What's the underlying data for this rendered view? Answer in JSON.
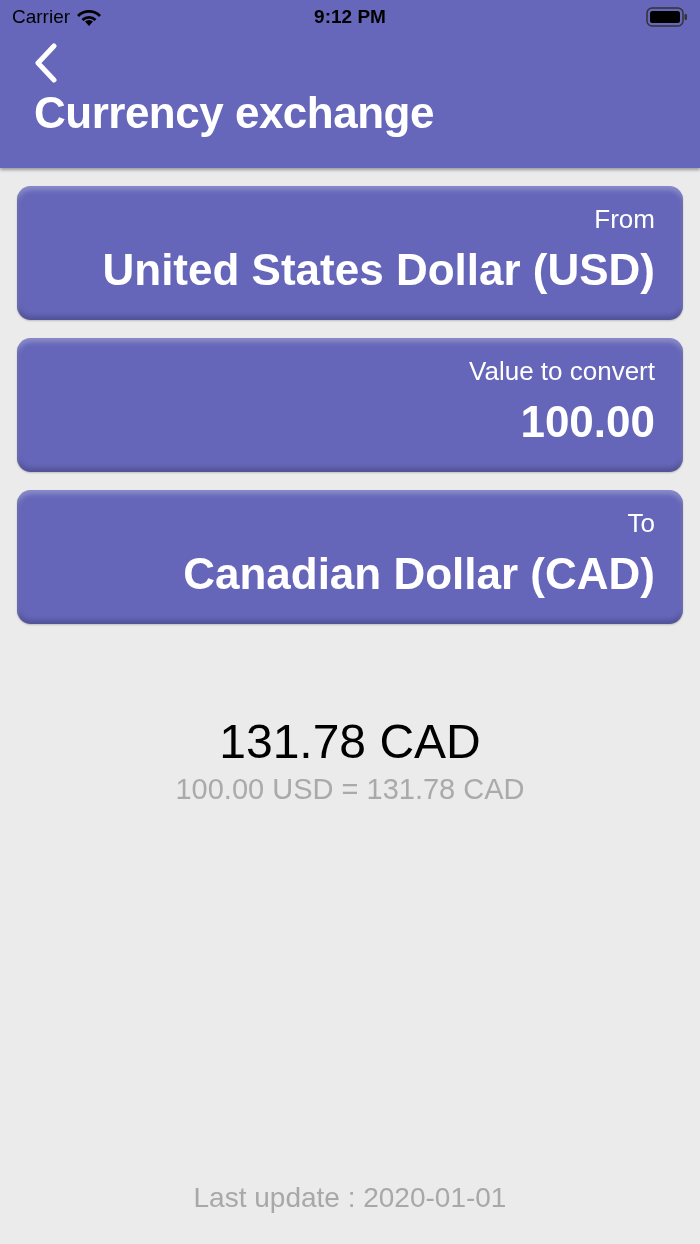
{
  "status_bar": {
    "carrier": "Carrier",
    "time": "9:12 PM"
  },
  "nav": {
    "title": "Currency exchange"
  },
  "fields": [
    {
      "label": "From",
      "value": "United States Dollar (USD)"
    },
    {
      "label": "Value to convert",
      "value": "100.00"
    },
    {
      "label": "To",
      "value": "Canadian Dollar (CAD)"
    }
  ],
  "result": {
    "amount": "131.78 CAD",
    "rate": "100.00 USD = 131.78 CAD"
  },
  "footer": {
    "last_update": "Last update : 2020-01-01"
  }
}
